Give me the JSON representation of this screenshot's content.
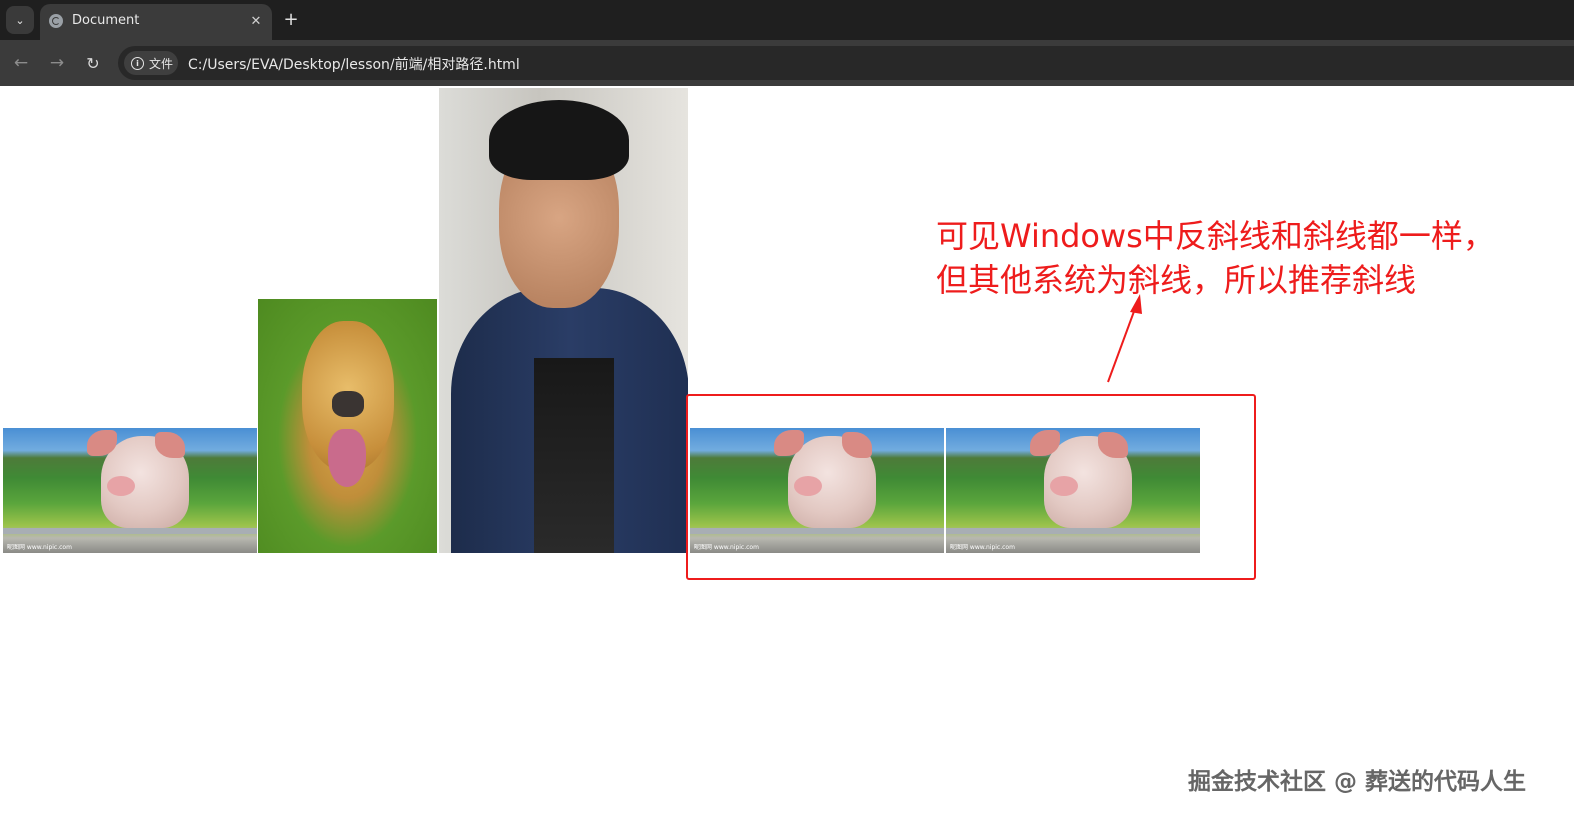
{
  "browser": {
    "tab_title": "Document",
    "tab_close_glyph": "✕",
    "new_tab_glyph": "+",
    "tab_search_glyph": "⌄",
    "back_glyph": "←",
    "forward_glyph": "→",
    "reload_glyph": "↻",
    "site_chip_label": "文件",
    "info_glyph": "i",
    "url": "C:/Users/EVA/Desktop/lesson/前端/相对路径.html"
  },
  "page": {
    "images": [
      {
        "subject": "pig",
        "credit": "昵图网 www.nipic.com"
      },
      {
        "subject": "golden-retriever-dog"
      },
      {
        "subject": "man-in-blue-jacket"
      },
      {
        "subject": "pig",
        "credit": "昵图网 www.nipic.com"
      },
      {
        "subject": "pig",
        "credit": "昵图网 www.nipic.com"
      }
    ]
  },
  "annotation": {
    "line1": "可见Windows中反斜线和斜线都一样，",
    "line2": "但其他系统为斜线，所以推荐斜线",
    "color": "#ee1c1c"
  },
  "watermark": "掘金技术社区 @ 葬送的代码人生",
  "icons": [
    "tab-search-icon",
    "globe-icon",
    "close-icon",
    "plus-icon",
    "back-icon",
    "forward-icon",
    "reload-icon",
    "info-icon"
  ]
}
